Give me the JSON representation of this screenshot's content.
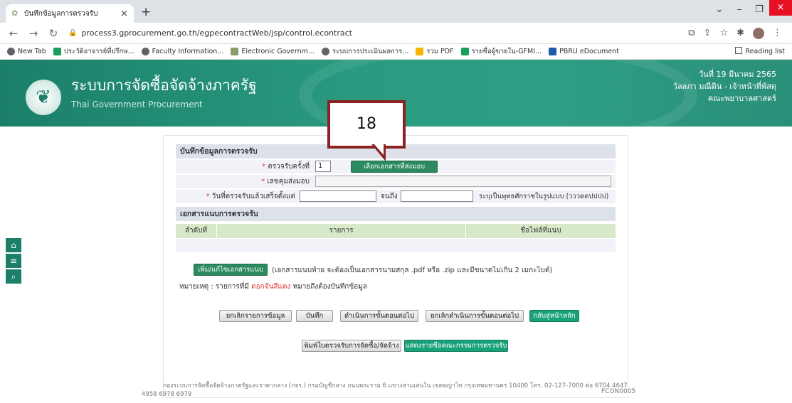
{
  "browser": {
    "tab_title": "บันทึกข้อมูลการตรวจรับ",
    "tab_close": "×",
    "new_tab": "+",
    "url": "process3.gprocurement.go.th/egpecontractWeb/jsp/control.econtract",
    "bookmarks": [
      {
        "label": "New Tab",
        "color": "#5f6368"
      },
      {
        "label": "ประวัติอาจารย์ที่ปรึกษ...",
        "color": "#1a9c5b"
      },
      {
        "label": "Faculty Information...",
        "color": "#5f6368"
      },
      {
        "label": "Electronic Governm...",
        "color": "#8b9d6a"
      },
      {
        "label": "ระบบการประเมินผลการ...",
        "color": "#5f6368"
      },
      {
        "label": "รวม PDF",
        "color": "#f4b400"
      },
      {
        "label": "รายชื่อผู้ขายใน-GFMI...",
        "color": "#1a9c5b"
      },
      {
        "label": "PBRU eDocument",
        "color": "#1e5aa8"
      }
    ],
    "reading_list": "Reading list"
  },
  "header": {
    "system_title": "ระบบการจัดซื้อจัดจ้างภาครัฐ",
    "system_subtitle": "Thai Government Procurement",
    "date": "วันที่ 19 มีนาคม 2565",
    "user": "วัลลภา มณีดิน - เจ้าหน้าที่พัสดุ",
    "department": "คณะพยาบาลศาสตร์"
  },
  "form": {
    "section_title": "บันทึกข้อมูลการตรวจรับ",
    "inspection_round_label": "ตรวจรับครั้งที่",
    "inspection_round_value": "1",
    "select_document_button": "เลือกเอกสารที่ส่งมอบ",
    "delivery_no_label": "เลขคุมส่งมอบ",
    "delivery_no_value": "",
    "completed_date_label": "วันที่ตรวจรับแล้วเสร็จตั้งแต่",
    "date_from_value": "",
    "until_label": "จนถึง",
    "date_to_value": "",
    "date_hint": "ระบุเป็นพุทธศักราชในรูปแบบ (วววดดปปปป)"
  },
  "attachments": {
    "section_title": "เอกสารแนบการตรวจรับ",
    "columns": [
      "ลำดับที่",
      "รายการ",
      "ชื่อไฟล์ที่แนบ"
    ],
    "rows": [],
    "add_button": "เพิ่ม/แก้ไขเอกสารแนบ",
    "attachment_note": "(เอกสารแนบท้าย จะต้องเป็นเอกสารนามสกุล .pdf หรือ .zip และมีขนาดไม่เกิน 2 เมกะไบต์)"
  },
  "remark": {
    "prefix": "หมายเหตุ : รายการที่มี",
    "highlight": "ดอกจันสีแดง",
    "suffix": "หมายถึงต้องบันทึกข้อมูล"
  },
  "actions": {
    "cancel_data": "ยกเลิกรายการข้อมูล",
    "save": "บันทึก",
    "next_step": "ดำเนินการขั้นตอนต่อไป",
    "cancel_next_step": "ยกเลิกดำเนินการขั้นตอนต่อไป",
    "back_home": "กลับสู่หน้าหลัก",
    "print_receipt": "พิมพ์ใบตรวจรับการจัดซื้อ/จัดจ้าง",
    "show_committee": "แสดงรายชื่อคณะกรรมการตรวจรับ"
  },
  "footer": {
    "address": "กองระบบการจัดซื้อจัดจ้างภาครัฐและราคากลาง (กจร.) กรมบัญชีกลาง ถนนพระราม 6 แขวงสามเสนใน เขตพญาไท กรุงเทพมหานคร 10400 โทร. 02-127-7000 ต่อ 6704 4647",
    "phone_cont": "4958 6978 6979",
    "screen_code": "FCON0005"
  },
  "annotation": {
    "step_number": "18"
  },
  "colors": {
    "header_green": "#1b7f6a",
    "button_green": "#2b8a5e",
    "required_red": "#e53935",
    "callout_border": "#8b2323"
  }
}
